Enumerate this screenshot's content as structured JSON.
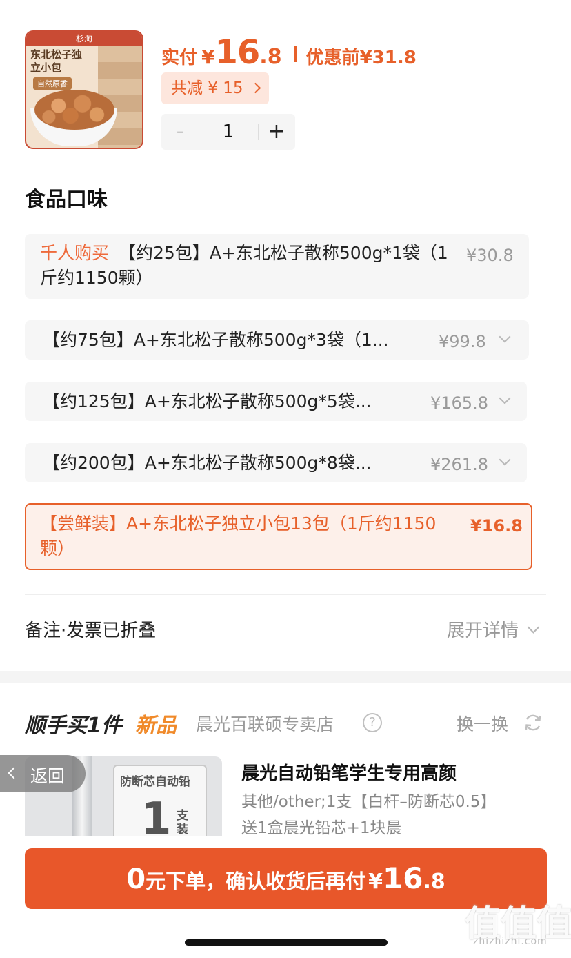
{
  "product": {
    "thumb_brand": "杉淘",
    "thumb_title": "东北松子独立小包",
    "thumb_tag": "自然原香",
    "pay_label": "实付",
    "pay_currency": "¥",
    "pay_int": "16",
    "pay_dec": ".8",
    "before_label": "优惠前",
    "before_price": "¥31.8",
    "discount_label": "共减 ¥ 15",
    "quantity": "1",
    "minus": "-",
    "plus": "+"
  },
  "section_title": "食品口味",
  "options": [
    {
      "tag": "千人购买",
      "text": "【约25包】A+东北松子散称500g*1袋（1斤约1150颗）",
      "price": "¥30.8"
    },
    {
      "text": "【约75包】A+东北松子散称500g*3袋（1...",
      "price": "¥99.8"
    },
    {
      "text": "【约125包】A+东北松子散称500g*5袋...",
      "price": "¥165.8"
    },
    {
      "text": "【约200包】A+东北松子散称500g*8袋...",
      "price": "¥261.8"
    },
    {
      "text": "【尝鲜装】A+东北松子独立小包13包（1斤约1150颗）",
      "price": "¥16.8"
    }
  ],
  "remark": {
    "label": "备注·发票已折叠",
    "action": "展开详情"
  },
  "upsell": {
    "title": "顺手买1件",
    "badge": "新品",
    "store": "晨光百联硕专卖店",
    "help": "?",
    "swap": "换一换",
    "img_caption": "防断芯自动铅",
    "img_number": "1",
    "img_unit": "支装",
    "name": "晨光自动铅笔学生专用高颜",
    "spec": "其他/other;1支【白杆–防断芯0.5】送1盒晨光铅芯+1块晨"
  },
  "back_label": "返回",
  "cta": {
    "zero": "0",
    "text": "元下单，确认收货后再付",
    "currency": "¥",
    "int": "16",
    "dec": ".8"
  },
  "watermark": {
    "text": "值值值",
    "url": "zhizhizhi.com"
  },
  "colors": {
    "accent": "#e7602a",
    "cta": "#e8572a",
    "hot": "#ee6a3b",
    "new_badge": "#f08a2a"
  },
  "icons": [
    "chevron-right-icon",
    "chevron-down-icon",
    "help-circle-icon",
    "refresh-icon",
    "chevron-left-icon"
  ]
}
